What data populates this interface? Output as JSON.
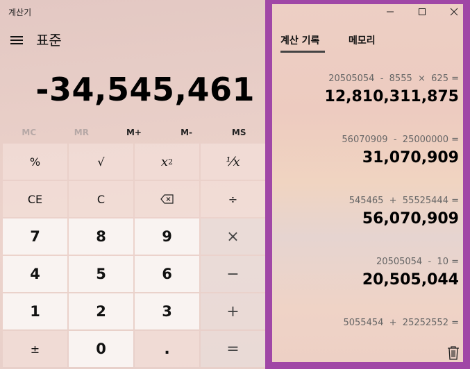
{
  "window": {
    "title": "계산기"
  },
  "mode": {
    "title": "표준"
  },
  "display": {
    "value": "-34,545,461"
  },
  "memory": [
    "MC",
    "MR",
    "M+",
    "M-",
    "MS"
  ],
  "keys": {
    "percent": "%",
    "sqrt": "√",
    "square": "x",
    "square_sup": "2",
    "reciprocal": "⅟x",
    "ce": "CE",
    "c": "C",
    "divide": "÷",
    "seven": "7",
    "eight": "8",
    "nine": "9",
    "multiply": "×",
    "four": "4",
    "five": "5",
    "six": "6",
    "minus": "−",
    "one": "1",
    "two": "2",
    "three": "3",
    "plus": "+",
    "negate": "±",
    "zero": "0",
    "decimal": ".",
    "equals": "="
  },
  "panel": {
    "tab_history": "계산 기록",
    "tab_memory": "메모리"
  },
  "history": [
    {
      "expr": "20505054  -  8555  ×  625 =",
      "result": "12,810,311,875"
    },
    {
      "expr": "56070909  -  25000000 =",
      "result": "31,070,909"
    },
    {
      "expr": "545465  +  55525444 =",
      "result": "56,070,909"
    },
    {
      "expr": "20505054  -  10 =",
      "result": "20,505,044"
    },
    {
      "expr": "5055454  +  25252552 =",
      "result": ""
    }
  ],
  "colors": {
    "panel_border": "#a047a6"
  },
  "icons": [
    "hamburger-icon",
    "backspace-icon",
    "minimize-icon",
    "maximize-icon",
    "close-icon",
    "trash-icon"
  ]
}
